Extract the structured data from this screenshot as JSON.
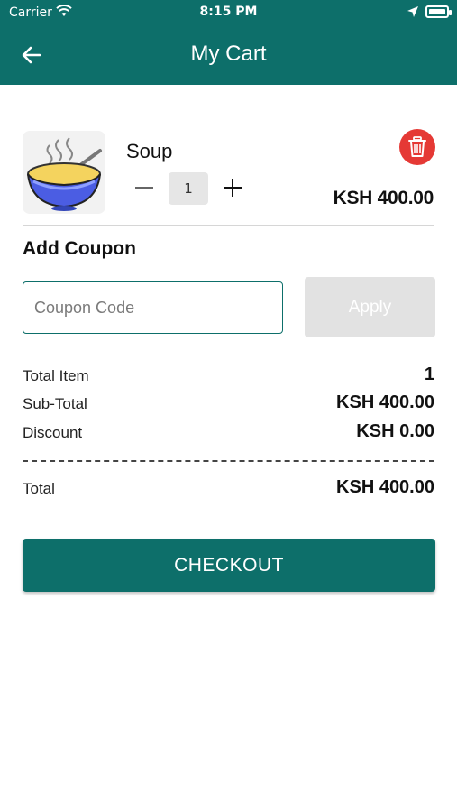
{
  "status_bar": {
    "carrier": "Carrier",
    "time": "8:15 PM"
  },
  "header": {
    "title": "My Cart",
    "back_icon": "arrow-left-icon"
  },
  "cart": {
    "items": [
      {
        "name": "Soup",
        "quantity": "1",
        "price": "KSH 400.00",
        "image_icon": "soup-bowl-icon"
      }
    ]
  },
  "coupon": {
    "title": "Add Coupon",
    "placeholder": "Coupon Code",
    "value": "",
    "apply_label": "Apply"
  },
  "summary": {
    "total_item_label": "Total Item",
    "total_item_value": "1",
    "subtotal_label": "Sub-Total",
    "subtotal_value": "KSH 400.00",
    "discount_label": "Discount",
    "discount_value": "KSH 0.00",
    "total_label": "Total",
    "total_value": "KSH 400.00"
  },
  "checkout_label": "CHECKOUT",
  "colors": {
    "primary": "#0d6f6a",
    "delete": "#e53935",
    "apply_disabled": "#e2e2e2"
  }
}
